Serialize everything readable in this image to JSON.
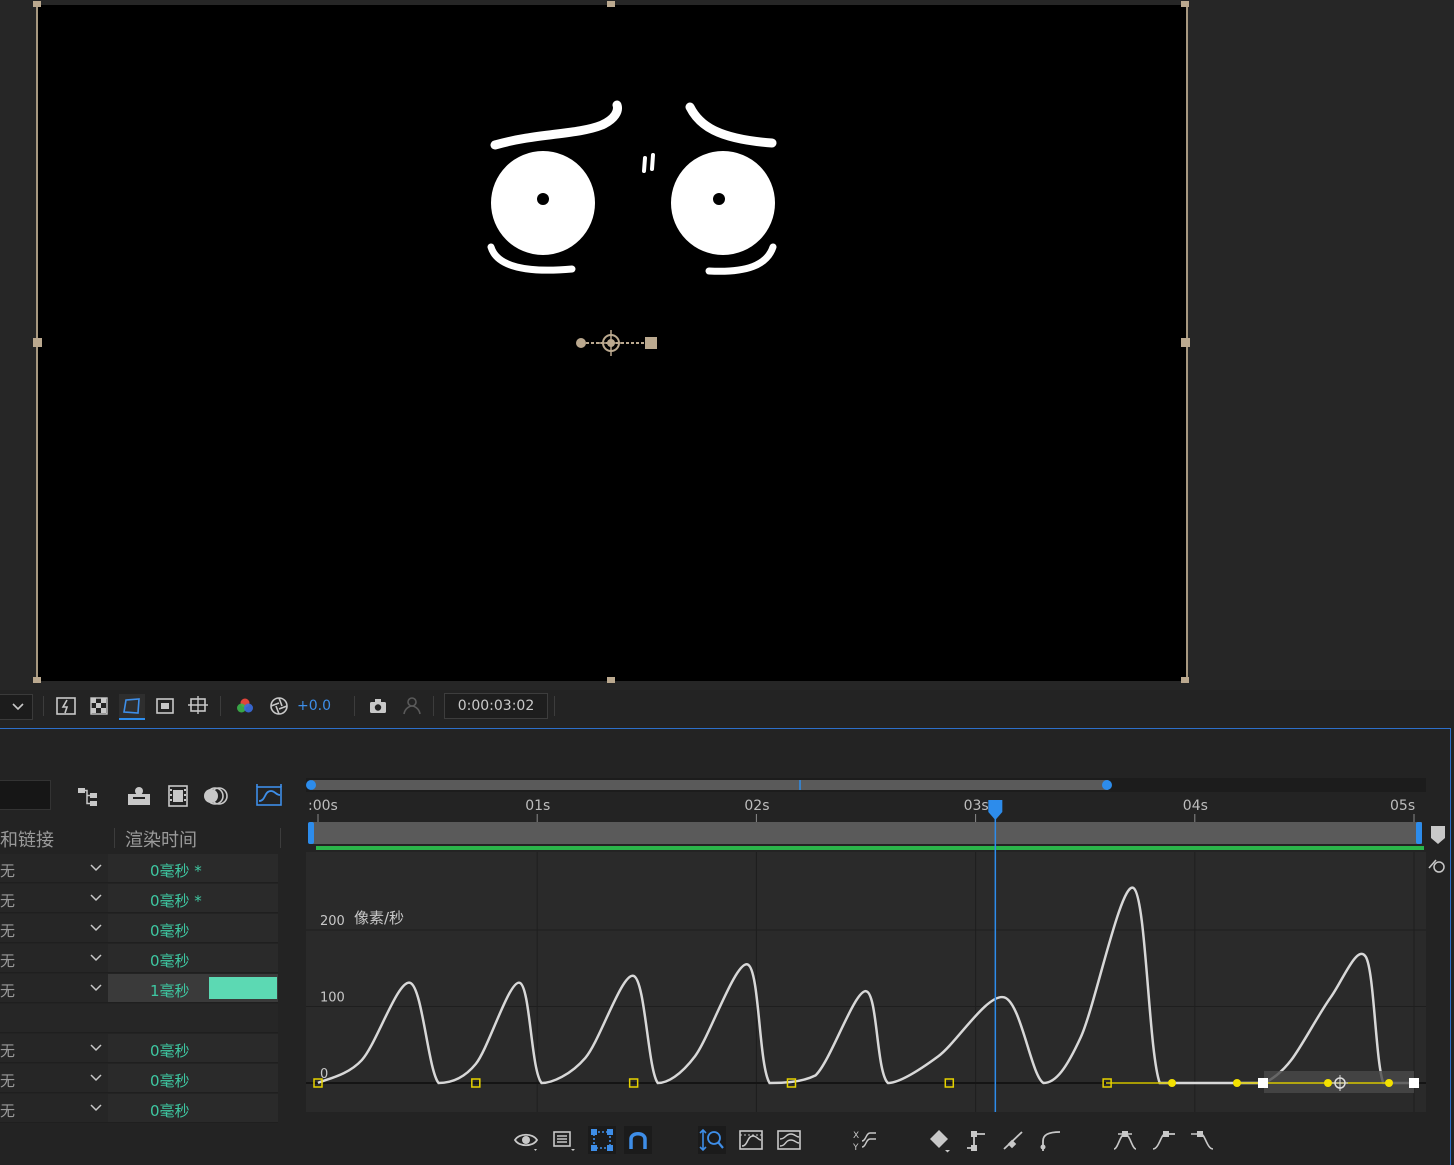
{
  "viewer": {
    "exposure_value": "+0.0",
    "timecode": "0:00:03:02"
  },
  "timeline": {
    "columns": {
      "parent_link": "和链接",
      "render_time": "渲染时间"
    },
    "layers": [
      {
        "render_time": "0毫秒 *",
        "selected": false
      },
      {
        "render_time": "0毫秒 *",
        "selected": false
      },
      {
        "render_time": "0毫秒",
        "selected": false
      },
      {
        "render_time": "0毫秒",
        "selected": false
      },
      {
        "render_time": "1毫秒",
        "selected": true
      },
      {
        "render_time": "",
        "selected": false
      },
      {
        "render_time": "0毫秒",
        "selected": false
      },
      {
        "render_time": "0毫秒",
        "selected": false
      },
      {
        "render_time": "0毫秒",
        "selected": false
      }
    ],
    "ruler_labels": [
      ":00s",
      "01s",
      "02s",
      "03s",
      "04s",
      "05s"
    ],
    "current_time_seconds": 3.09,
    "render_bar_color": "#3ec8a2",
    "accent_color": "#2d8ceb"
  },
  "chart_data": {
    "type": "line",
    "series": [
      {
        "x": [
          0.0,
          0.2,
          0.42,
          0.55,
          0.72,
          0.92,
          1.02,
          1.22,
          1.44,
          1.55,
          1.72,
          1.96,
          2.06,
          2.27,
          2.5,
          2.6,
          2.83,
          3.13,
          3.31,
          3.48,
          3.72,
          3.84,
          4.04,
          4.26,
          4.32,
          4.44,
          4.62,
          4.78,
          4.86,
          5.0
        ],
        "y": [
          0,
          30,
          131,
          0,
          25,
          131,
          0,
          33,
          140,
          0,
          35,
          155,
          0,
          10,
          120,
          0,
          35,
          112,
          0,
          60,
          255,
          0,
          0,
          0,
          0,
          30,
          112,
          165,
          0,
          0
        ]
      }
    ],
    "xlim": [
      0,
      5
    ],
    "ylim": [
      0,
      280
    ],
    "ylabel": "像素/秒",
    "y_ticks": [
      0,
      100,
      200
    ],
    "y_tick_labels": [
      "0",
      "100",
      "200"
    ],
    "keyframes_x": [
      0.0,
      0.72,
      1.44,
      2.16,
      2.88,
      3.6,
      4.26,
      4.94
    ],
    "grid": true
  }
}
